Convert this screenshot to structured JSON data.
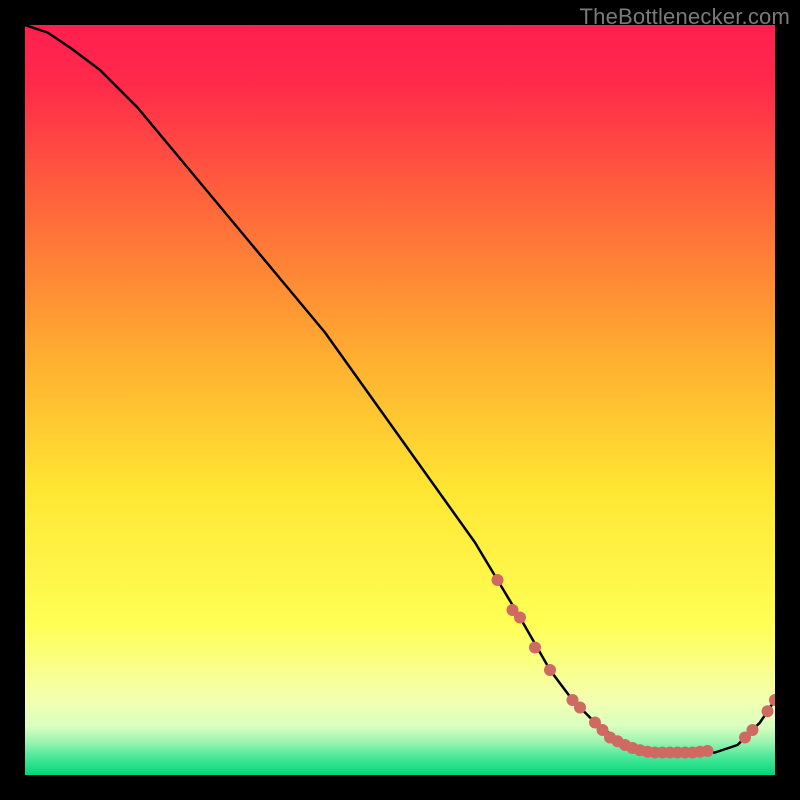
{
  "attribution": "TheBottlenecker.com",
  "chart_data": {
    "type": "line",
    "title": "",
    "xlabel": "",
    "ylabel": "",
    "xlim": [
      0,
      100
    ],
    "ylim": [
      0,
      100
    ],
    "background_gradient": {
      "top_color": "#ff1f4f",
      "mid_color": "#ffe633",
      "bottom_color": "#00d77a"
    },
    "series": [
      {
        "name": "bottleneck-curve",
        "x": [
          0,
          3,
          6,
          10,
          15,
          20,
          25,
          30,
          35,
          40,
          45,
          50,
          55,
          60,
          63,
          66,
          70,
          73,
          76,
          80,
          84,
          88,
          92,
          95,
          98,
          100
        ],
        "y": [
          100,
          99,
          97,
          94,
          89,
          83,
          77,
          71,
          65,
          59,
          52,
          45,
          38,
          31,
          26,
          21,
          14,
          10,
          7,
          4,
          3,
          3,
          3,
          4,
          7,
          10
        ]
      }
    ],
    "markers": [
      {
        "x": 63,
        "y": 26
      },
      {
        "x": 65,
        "y": 22
      },
      {
        "x": 66,
        "y": 21
      },
      {
        "x": 68,
        "y": 17
      },
      {
        "x": 70,
        "y": 14
      },
      {
        "x": 73,
        "y": 10
      },
      {
        "x": 74,
        "y": 9
      },
      {
        "x": 76,
        "y": 7
      },
      {
        "x": 77,
        "y": 6
      },
      {
        "x": 78,
        "y": 5
      },
      {
        "x": 79,
        "y": 4.5
      },
      {
        "x": 80,
        "y": 4
      },
      {
        "x": 81,
        "y": 3.6
      },
      {
        "x": 82,
        "y": 3.3
      },
      {
        "x": 83,
        "y": 3.1
      },
      {
        "x": 84,
        "y": 3
      },
      {
        "x": 85,
        "y": 3
      },
      {
        "x": 86,
        "y": 3
      },
      {
        "x": 87,
        "y": 3
      },
      {
        "x": 88,
        "y": 3
      },
      {
        "x": 89,
        "y": 3
      },
      {
        "x": 90,
        "y": 3.1
      },
      {
        "x": 91,
        "y": 3.2
      },
      {
        "x": 96,
        "y": 5
      },
      {
        "x": 97,
        "y": 6
      },
      {
        "x": 99,
        "y": 8.5
      },
      {
        "x": 100,
        "y": 10
      }
    ]
  },
  "colors": {
    "curve": "#000000",
    "marker": "#cf6a62"
  }
}
